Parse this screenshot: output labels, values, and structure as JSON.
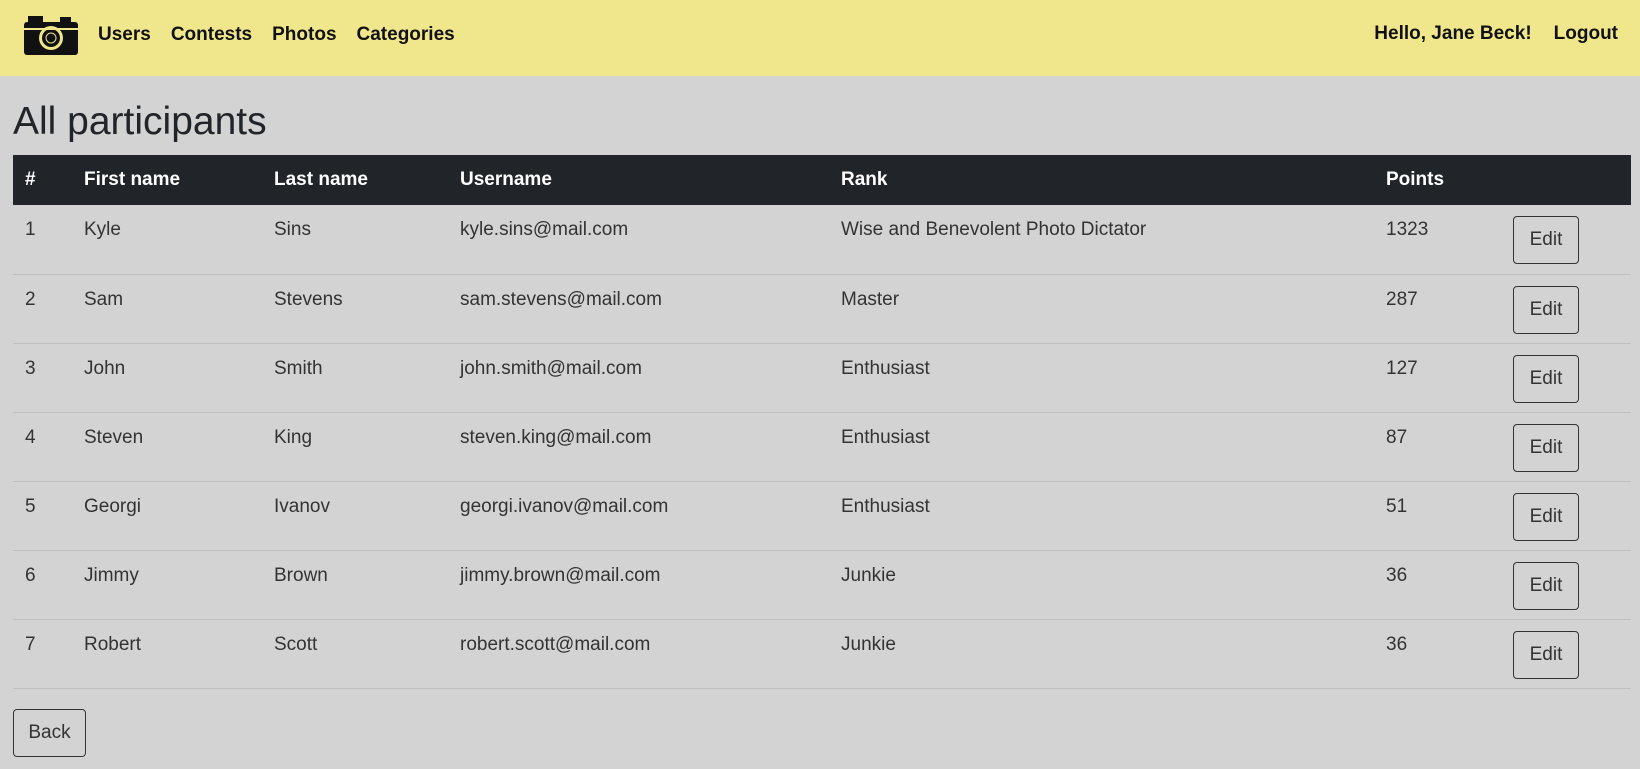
{
  "nav": {
    "links": [
      "Users",
      "Contests",
      "Photos",
      "Categories"
    ],
    "greeting": "Hello, Jane Beck!",
    "logout": "Logout",
    "logo_icon": "camera-icon"
  },
  "page": {
    "title": "All participants",
    "back_label": "Back",
    "edit_label": "Edit"
  },
  "table": {
    "headers": [
      "#",
      "First name",
      "Last name",
      "Username",
      "Rank",
      "Points"
    ],
    "rows": [
      {
        "num": "1",
        "first": "Kyle",
        "last": "Sins",
        "username": "kyle.sins@mail.com",
        "rank": "Wise and Benevolent Photo Dictator",
        "points": "1323"
      },
      {
        "num": "2",
        "first": "Sam",
        "last": "Stevens",
        "username": "sam.stevens@mail.com",
        "rank": "Master",
        "points": "287"
      },
      {
        "num": "3",
        "first": "John",
        "last": "Smith",
        "username": "john.smith@mail.com",
        "rank": "Enthusiast",
        "points": "127"
      },
      {
        "num": "4",
        "first": "Steven",
        "last": "King",
        "username": "steven.king@mail.com",
        "rank": "Enthusiast",
        "points": "87"
      },
      {
        "num": "5",
        "first": "Georgi",
        "last": "Ivanov",
        "username": "georgi.ivanov@mail.com",
        "rank": "Enthusiast",
        "points": "51"
      },
      {
        "num": "6",
        "first": "Jimmy",
        "last": "Brown",
        "username": "jimmy.brown@mail.com",
        "rank": "Junkie",
        "points": "36"
      },
      {
        "num": "7",
        "first": "Robert",
        "last": "Scott",
        "username": "robert.scott@mail.com",
        "rank": "Junkie",
        "points": "36"
      }
    ]
  },
  "colors": {
    "navbar_bg": "#f0e68c",
    "page_bg": "#d3d3d3",
    "table_header_bg": "#212529"
  }
}
